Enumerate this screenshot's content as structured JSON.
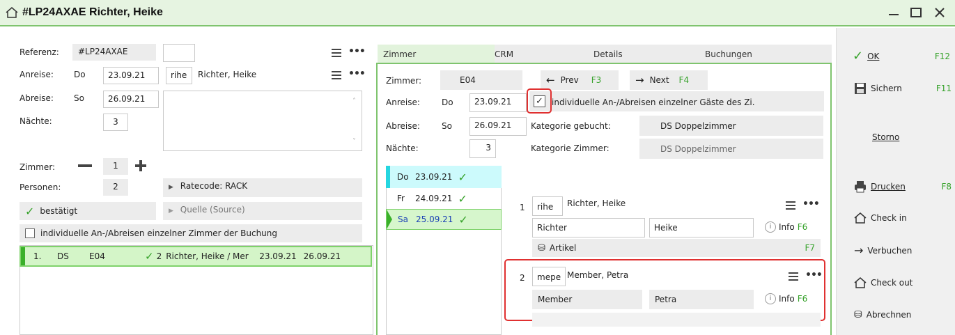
{
  "window": {
    "title": "#LP24AXAE Richter, Heike"
  },
  "left": {
    "ref_label": "Referenz:",
    "ref_value": "#LP24AXAE",
    "arrival_label": "Anreise:",
    "arrival_day": "Do",
    "arrival_date": "23.09.21",
    "guest_code": "rihe",
    "guest_name": "Richter, Heike",
    "departure_label": "Abreise:",
    "departure_day": "So",
    "departure_date": "26.09.21",
    "nights_label": "Nächte:",
    "nights_value": "3",
    "rooms_label": "Zimmer:",
    "rooms_value": "1",
    "persons_label": "Personen:",
    "persons_value": "2",
    "ratecode": "Ratecode: RACK",
    "status": "bestätigt",
    "source": "Quelle (Source)",
    "individual_label": "individuelle An-/Abreisen einzelner Zimmer der Buchung",
    "booking_row": {
      "num": "1.",
      "cat": "DS",
      "room": "E04",
      "persons": "2",
      "guests": "Richter, Heike / Mer",
      "from": "23.09.21",
      "to": "26.09.21"
    }
  },
  "tabs": [
    "Zimmer",
    "CRM",
    "Details",
    "Buchungen"
  ],
  "center": {
    "room_label": "Zimmer:",
    "room_value": "E04",
    "prev_label": "Prev",
    "prev_key": "F3",
    "next_label": "Next",
    "next_key": "F4",
    "arrival_label": "Anreise:",
    "arrival_day": "Do",
    "arrival_date": "23.09.21",
    "individual_label": "individuelle An-/Abreisen einzelner Gäste des Zi.",
    "departure_label": "Abreise:",
    "departure_day": "So",
    "departure_date": "26.09.21",
    "cat_booked_label": "Kategorie gebucht:",
    "cat_booked_value": "DS Doppelzimmer",
    "nights_label": "Nächte:",
    "nights_value": "3",
    "cat_room_label": "Kategorie Zimmer:",
    "cat_room_value": "DS Doppelzimmer",
    "days": [
      {
        "day": "Do",
        "date": "23.09.21"
      },
      {
        "day": "Fr",
        "date": "24.09.21"
      },
      {
        "day": "Sa",
        "date": "25.09.21"
      }
    ],
    "guests": [
      {
        "num": "1",
        "code": "rihe",
        "name": "Richter, Heike",
        "last": "Richter",
        "first": "Heike",
        "info": "Info",
        "info_key": "F6",
        "article_label": "Artikel",
        "article_key": "F7"
      },
      {
        "num": "2",
        "code": "mepe",
        "name": "Member, Petra",
        "last": "Member",
        "first": "Petra",
        "info": "Info",
        "info_key": "F6"
      }
    ]
  },
  "actions": {
    "ok": "OK",
    "ok_key": "F12",
    "save": "Sichern",
    "save_key": "F11",
    "cancel": "Storno",
    "print": "Drucken",
    "print_key": "F8",
    "checkin": "Check in",
    "post": "Verbuchen",
    "checkout": "Check out",
    "bill": "Abrechnen"
  }
}
